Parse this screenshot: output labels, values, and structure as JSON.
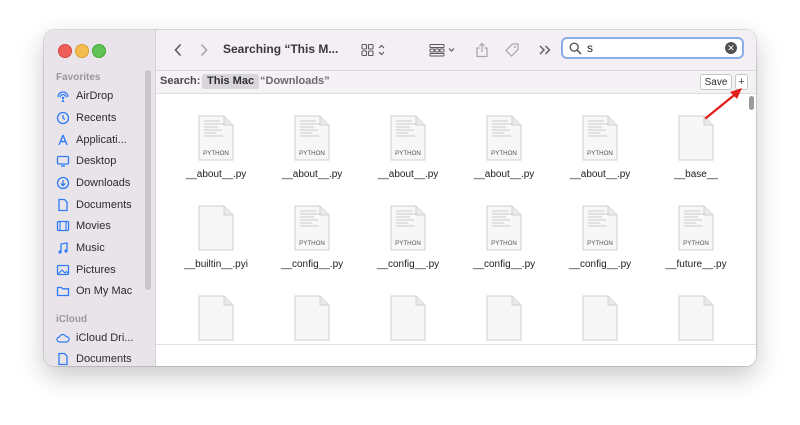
{
  "window": {
    "title": "Searching “This M...",
    "search_value": "s"
  },
  "sidebar": {
    "favorites_label": "Favorites",
    "favorites": [
      {
        "label": "AirDrop",
        "icon": "airdrop-icon"
      },
      {
        "label": "Recents",
        "icon": "clock-icon"
      },
      {
        "label": "Applicati...",
        "icon": "applications-icon"
      },
      {
        "label": "Desktop",
        "icon": "desktop-icon"
      },
      {
        "label": "Downloads",
        "icon": "download-icon"
      },
      {
        "label": "Documents",
        "icon": "document-icon"
      },
      {
        "label": "Movies",
        "icon": "film-icon"
      },
      {
        "label": "Music",
        "icon": "music-icon"
      },
      {
        "label": "Pictures",
        "icon": "picture-icon"
      },
      {
        "label": "On My Mac",
        "icon": "folder-icon"
      }
    ],
    "icloud_label": "iCloud",
    "icloud": [
      {
        "label": "iCloud Dri...",
        "icon": "cloud-icon"
      },
      {
        "label": "Documents",
        "icon": "document-icon"
      }
    ]
  },
  "scope": {
    "label": "Search:",
    "this_mac": "This Mac",
    "downloads": "“Downloads”",
    "save": "Save",
    "plus": "+"
  },
  "files": {
    "row1": [
      {
        "name": "__about__.py",
        "badge": "PYTHON"
      },
      {
        "name": "__about__.py",
        "badge": "PYTHON"
      },
      {
        "name": "__about__.py",
        "badge": "PYTHON"
      },
      {
        "name": "__about__.py",
        "badge": "PYTHON"
      },
      {
        "name": "__about__.py",
        "badge": "PYTHON"
      },
      {
        "name": "__base__",
        "badge": ""
      }
    ],
    "row2": [
      {
        "name": "__builtin__.pyi",
        "badge": ""
      },
      {
        "name": "__config__.py",
        "badge": "PYTHON"
      },
      {
        "name": "__config__.py",
        "badge": "PYTHON"
      },
      {
        "name": "__config__.py",
        "badge": "PYTHON"
      },
      {
        "name": "__config__.py",
        "badge": "PYTHON"
      },
      {
        "name": "__future__.py",
        "badge": "PYTHON"
      }
    ],
    "row3": [
      {
        "name": "",
        "badge": ""
      },
      {
        "name": "",
        "badge": ""
      },
      {
        "name": "",
        "badge": ""
      },
      {
        "name": "",
        "badge": ""
      },
      {
        "name": "",
        "badge": ""
      },
      {
        "name": "",
        "badge": ""
      }
    ]
  },
  "colors": {
    "annotation_arrow": "#e0201c",
    "sidebar_icon": "#2f7cf6"
  }
}
